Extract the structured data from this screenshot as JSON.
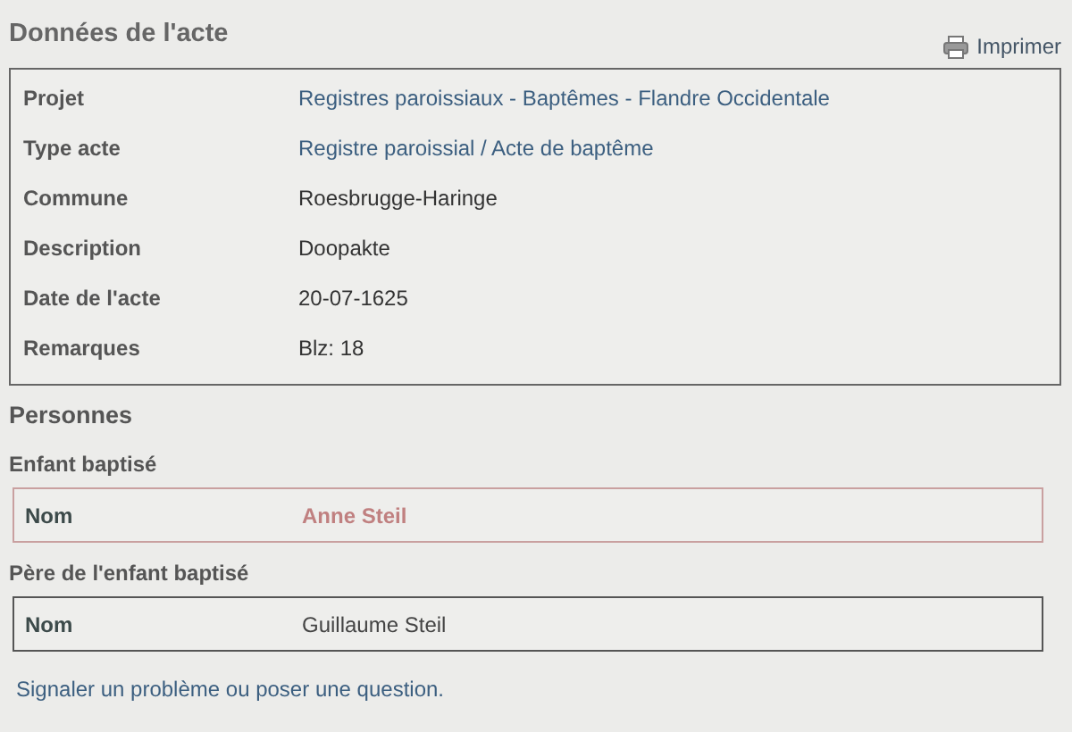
{
  "title": "Données de l'acte",
  "print_link": "Imprimer",
  "details": [
    {
      "label": "Projet",
      "value": "Registres paroissiaux - Baptêmes - Flandre Occidentale",
      "kind": "link"
    },
    {
      "label": "Type acte",
      "value": "Registre paroissial / Acte de baptême",
      "kind": "link"
    },
    {
      "label": "Commune",
      "value": "Roesbrugge-Haringe",
      "kind": "text"
    },
    {
      "label": "Description",
      "value": "Doopakte",
      "kind": "text"
    },
    {
      "label": "Date de l'acte",
      "value": "20-07-1625",
      "kind": "text"
    },
    {
      "label": "Remarques",
      "value": "Blz: 18",
      "kind": "text"
    }
  ],
  "persons_heading": "Personnes",
  "persons": [
    {
      "role": "Enfant baptisé",
      "label": "Nom",
      "name": "Anne Steil",
      "highlighted": true
    },
    {
      "role": "Père de l'enfant baptisé",
      "label": "Nom",
      "name": "Guillaume Steil",
      "highlighted": false
    }
  ],
  "report_link": "Signaler un problème ou poser une question."
}
